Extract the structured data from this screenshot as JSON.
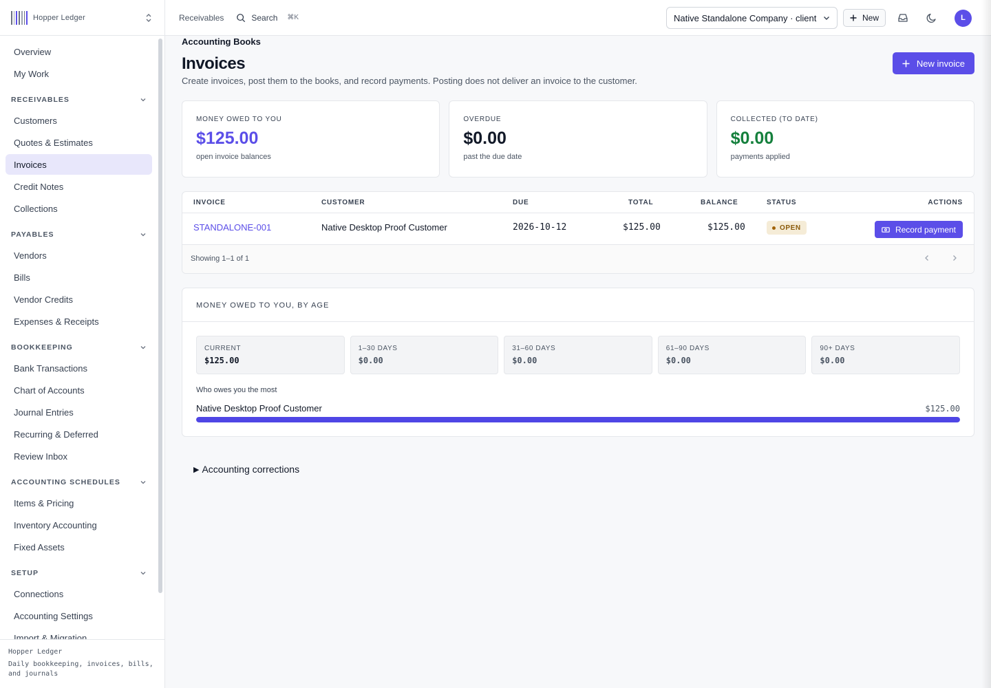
{
  "brand": {
    "sub": "Hopper Ledger",
    "main": "Accounting Books"
  },
  "nav": {
    "top": [
      {
        "label": "Overview"
      },
      {
        "label": "My Work"
      }
    ],
    "sections": [
      {
        "title": "RECEIVABLES",
        "items": [
          "Customers",
          "Quotes & Estimates",
          "Invoices",
          "Credit Notes",
          "Collections"
        ]
      },
      {
        "title": "PAYABLES",
        "items": [
          "Vendors",
          "Bills",
          "Vendor Credits",
          "Expenses & Receipts"
        ]
      },
      {
        "title": "BOOKKEEPING",
        "items": [
          "Bank Transactions",
          "Chart of Accounts",
          "Journal Entries",
          "Recurring & Deferred",
          "Review Inbox"
        ]
      },
      {
        "title": "ACCOUNTING SCHEDULES",
        "items": [
          "Items & Pricing",
          "Inventory Accounting",
          "Fixed Assets"
        ]
      },
      {
        "title": "SETUP",
        "items": [
          "Connections",
          "Accounting Settings",
          "Import & Migration"
        ]
      }
    ],
    "active": "Invoices"
  },
  "footer": {
    "line1": "Hopper Ledger",
    "line2": "Daily bookkeeping, invoices, bills, and journals"
  },
  "topbar": {
    "breadcrumb": "Receivables",
    "search_label": "Search",
    "search_shortcut": "⌘K",
    "company": "Native Standalone Company · client",
    "new_label": "New",
    "avatar_initial": "L"
  },
  "page": {
    "title": "Invoices",
    "description": "Create invoices, post them to the books, and record payments. Posting does not deliver an invoice to the customer.",
    "new_invoice_label": "New invoice"
  },
  "stats": [
    {
      "label": "MONEY OWED TO YOU",
      "value": "$125.00",
      "note": "open invoice balances",
      "color": "#5b4ee8"
    },
    {
      "label": "OVERDUE",
      "value": "$0.00",
      "note": "past the due date",
      "color": "#111827"
    },
    {
      "label": "COLLECTED (TO DATE)",
      "value": "$0.00",
      "note": "payments applied",
      "color": "#15803d"
    }
  ],
  "table": {
    "headers": {
      "invoice": "INVOICE",
      "customer": "CUSTOMER",
      "due": "DUE",
      "total": "TOTAL",
      "balance": "BALANCE",
      "status": "STATUS",
      "actions": "ACTIONS"
    },
    "rows": [
      {
        "invoice": "STANDALONE-001",
        "customer": "Native Desktop Proof Customer",
        "due": "2026-10-12",
        "total": "$125.00",
        "balance": "$125.00",
        "status": "OPEN",
        "action": "Record payment"
      }
    ],
    "showing": "Showing 1–1 of 1"
  },
  "aging": {
    "title": "MONEY OWED TO YOU, BY AGE",
    "buckets": [
      {
        "label": "CURRENT",
        "value": "$125.00"
      },
      {
        "label": "1–30 DAYS",
        "value": "$0.00"
      },
      {
        "label": "31–60 DAYS",
        "value": "$0.00"
      },
      {
        "label": "61–90 DAYS",
        "value": "$0.00"
      },
      {
        "label": "90+ DAYS",
        "value": "$0.00"
      }
    ],
    "top_label": "Who owes you the most",
    "top_debtor": {
      "name": "Native Desktop Proof Customer",
      "amount": "$125.00",
      "share": 1.0
    }
  },
  "corrections_label": "Accounting corrections",
  "colors": {
    "accent": "#5b4ee8",
    "positive": "#15803d",
    "open_badge_bg": "#f5ecd7"
  }
}
